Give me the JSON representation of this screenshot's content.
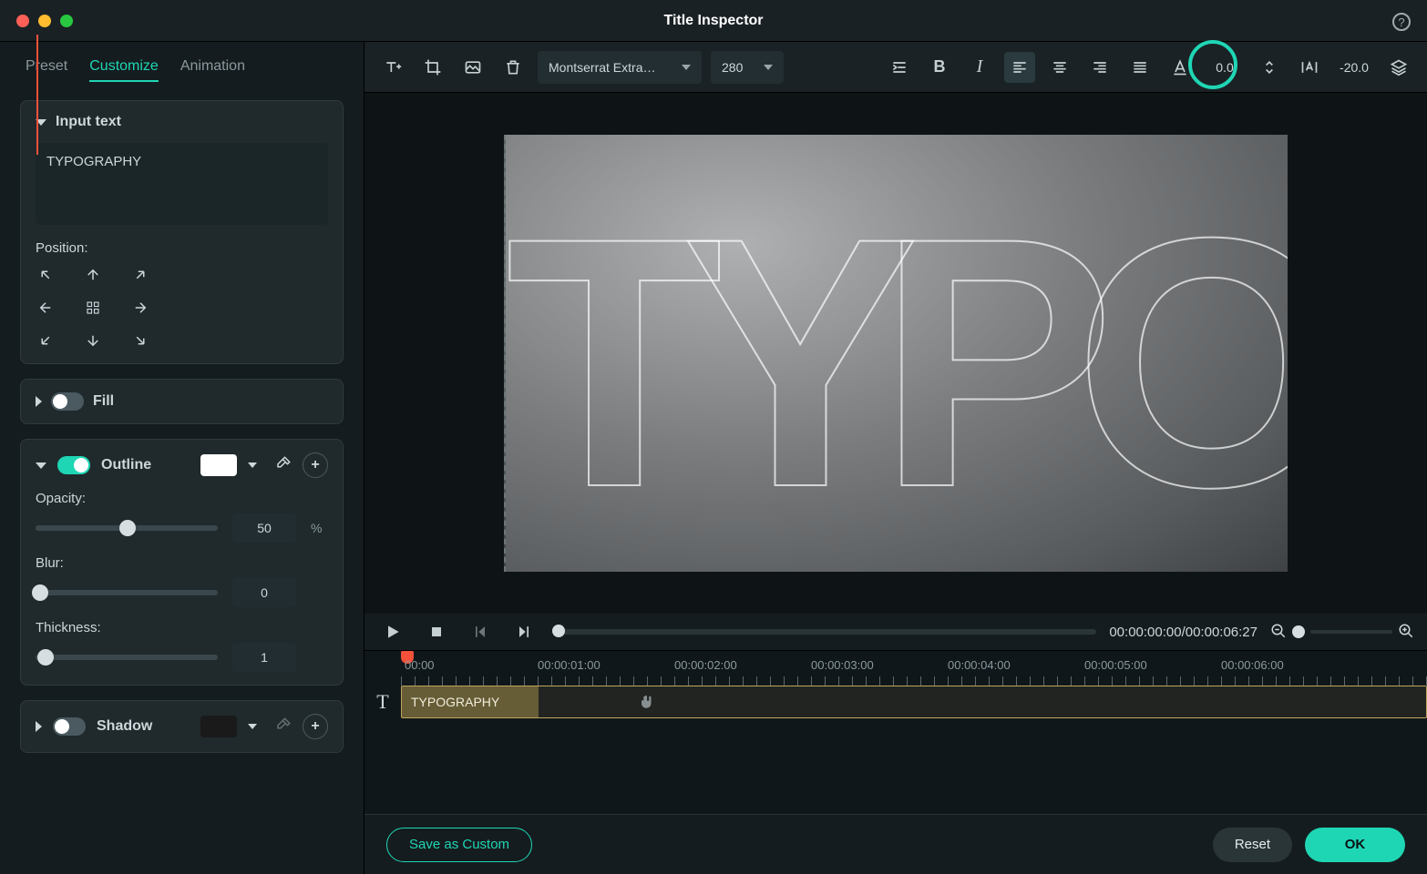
{
  "window": {
    "title": "Title Inspector"
  },
  "tabs": {
    "preset": "Preset",
    "customize": "Customize",
    "animation": "Animation"
  },
  "inputText": {
    "header": "Input text",
    "value": "TYPOGRAPHY",
    "positionLabel": "Position:"
  },
  "fill": {
    "label": "Fill",
    "enabled": false
  },
  "outline": {
    "label": "Outline",
    "enabled": true,
    "color": "#ffffff",
    "opacityLabel": "Opacity:",
    "opacityValue": "50",
    "opacityUnit": "%",
    "blurLabel": "Blur:",
    "blurValue": "0",
    "thicknessLabel": "Thickness:",
    "thicknessValue": "1"
  },
  "shadow": {
    "label": "Shadow",
    "enabled": false
  },
  "toolbar": {
    "font": "Montserrat Extra…",
    "size": "280",
    "lineSpacing": "0.0",
    "charSpacing": "-20.0"
  },
  "canvas": {
    "text": "TYPOGRAPHY"
  },
  "playback": {
    "timecode": "00:00:00:00/00:00:06:27"
  },
  "timeline": {
    "labels": [
      "00:00",
      "00:00:01:00",
      "00:00:02:00",
      "00:00:03:00",
      "00:00:04:00",
      "00:00:05:00",
      "00:00:06:00"
    ],
    "clipLabel": "TYPOGRAPHY"
  },
  "footer": {
    "save": "Save as Custom",
    "reset": "Reset",
    "ok": "OK"
  }
}
